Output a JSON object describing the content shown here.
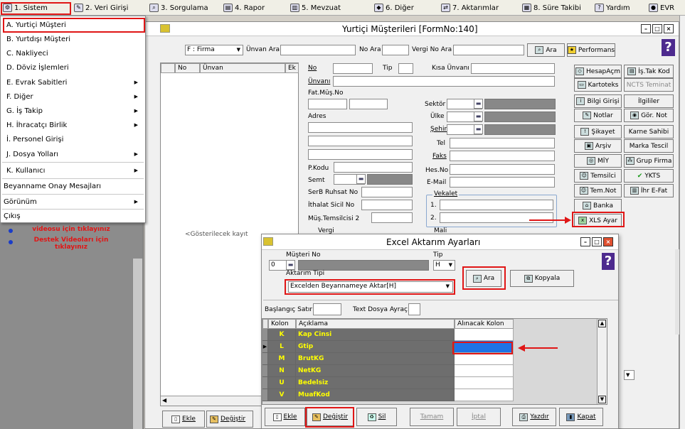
{
  "menubar": {
    "items": [
      {
        "label": "1. Sistem",
        "icon": "system-icon"
      },
      {
        "label": "2. Veri Girişi",
        "icon": "data-entry-icon"
      },
      {
        "label": "3. Sorgulama",
        "icon": "query-icon"
      },
      {
        "label": "4. Rapor",
        "icon": "report-icon"
      },
      {
        "label": "5. Mevzuat",
        "icon": "legislation-icon"
      },
      {
        "label": "6. Diğer",
        "icon": "other-icon"
      },
      {
        "label": "7. Aktarımlar",
        "icon": "transfer-icon"
      },
      {
        "label": "8. Süre Takibi",
        "icon": "calendar-icon"
      },
      {
        "label": "Yardım",
        "icon": "help-icon"
      },
      {
        "label": "EVR",
        "icon": "evr-icon"
      }
    ]
  },
  "dropdown": {
    "items": [
      {
        "label": "A. Yurtiçi Müşteri",
        "has_submenu": false
      },
      {
        "label": "B. Yurtdışı Müşteri",
        "has_submenu": false
      },
      {
        "label": "C. Nakliyeci",
        "has_submenu": false
      },
      {
        "label": "D. Döviz İşlemleri",
        "has_submenu": false
      },
      {
        "label": "E. Evrak Sabitleri",
        "has_submenu": true
      },
      {
        "label": "F. Diğer",
        "has_submenu": true
      },
      {
        "label": "G. İş Takip",
        "has_submenu": true
      },
      {
        "label": "H. İhracatçı Birlik",
        "has_submenu": true
      },
      {
        "label": "İ. Personel Girişi",
        "has_submenu": false
      },
      {
        "label": "J. Dosya Yolları",
        "has_submenu": true
      },
      {
        "label": "K. Kullanıcı",
        "has_submenu": true
      },
      {
        "label": "Beyanname Onay Mesajları",
        "has_submenu": false
      },
      {
        "label": "Görünüm",
        "has_submenu": true
      },
      {
        "label": "Çıkış",
        "has_submenu": false
      }
    ]
  },
  "sidepanel": {
    "link1": "videosu için tıklayınız",
    "link2": "Destek Videoları için tıklayınız"
  },
  "mainwin": {
    "title": "Yurtiçi Müşterileri [FormNo:140]",
    "filter": {
      "select_value": "F : Firma",
      "unvan_label": "Ünvan Ara",
      "no_label": "No Ara",
      "vergi_label": "Vergi No Ara",
      "search_btn": "Ara",
      "perf_btn": "Performans"
    },
    "list_headers": [
      "No",
      "Ünvan",
      "Ek"
    ],
    "list_empty": "<Gösterilecek kayıt",
    "form": {
      "no": "No",
      "tip": "Tip",
      "kisa_unvan": "Kısa Ünvanı",
      "unvani": "Ünvanı",
      "fat_mus_no": "Fat.Müş.No",
      "sektor": "Sektör",
      "ulke": "Ülke",
      "adres": "Adres",
      "sehir": "Şehir",
      "tel": "Tel",
      "faks": "Faks",
      "pkodu": "P.Kodu",
      "hesno": "Hes.No",
      "semt": "Semt",
      "email": "E-Mail",
      "serb": "SerB Ruhsat No",
      "vekalet": "Vekalet",
      "ithalat": "İthalat Sicil No",
      "v1": "1.",
      "mustem": "Müş.Temsilcisi 2",
      "v2": "2.",
      "vergi": "Vergi",
      "mali": "Mali"
    },
    "right_buttons": [
      [
        "HesapAçm",
        "İş.Tak Kod"
      ],
      [
        "Kartoteks",
        "NCTS Teminat"
      ],
      [
        "Bilgi Girişi",
        "İlgililer"
      ],
      [
        "Notlar",
        "Gör. Not"
      ],
      [
        "Şikayet",
        "Karne Sahibi"
      ],
      [
        "Arşiv",
        "Marka Tescil"
      ],
      [
        "MİY",
        "Grup Firma"
      ],
      [
        "Temsilci",
        "YKTS"
      ],
      [
        "Tem.Not",
        "İhr E-Fat"
      ],
      [
        "Banka",
        ""
      ],
      [
        "XLS Ayar",
        ""
      ]
    ],
    "bottom": {
      "ekle": "Ekle",
      "degistir": "Değiştir"
    }
  },
  "dialog": {
    "title": "Excel Aktarım Ayarları",
    "musteri_label": "Müşteri No",
    "musteri_value": "0",
    "tip_label": "Tip",
    "tip_value": "H",
    "aktarim_label": "Aktarım Tipi",
    "aktarim_value": "Excelden Beyannameye Aktar[H]",
    "ara_btn": "Ara",
    "kopyala_btn": "Kopyala",
    "baslangic_label": "Başlangıç Satır",
    "text_label": "Text Dosya Ayraç",
    "grid_headers": [
      "Kolon",
      "Açıklama",
      "Alınacak Kolon"
    ],
    "grid_rows": [
      {
        "kolon": "K",
        "aciklama": "Kap Cinsi"
      },
      {
        "kolon": "L",
        "aciklama": "Gtip"
      },
      {
        "kolon": "M",
        "aciklama": "BrutKG"
      },
      {
        "kolon": "N",
        "aciklama": "NetKG"
      },
      {
        "kolon": "U",
        "aciklama": "Bedelsiz"
      },
      {
        "kolon": "V",
        "aciklama": "MuafKod"
      }
    ],
    "buttons": {
      "ekle": "Ekle",
      "degistir": "Değiştir",
      "sil": "Sil",
      "tamam": "Tamam",
      "iptal": "İptal",
      "yazdir": "Yazdır",
      "kapat": "Kapat"
    }
  },
  "colors": {
    "highlight_red": "#e01616",
    "grid_text": "#ffff00",
    "grid_bg": "#6e6e6e",
    "selected_blue": "#1e73e6"
  }
}
